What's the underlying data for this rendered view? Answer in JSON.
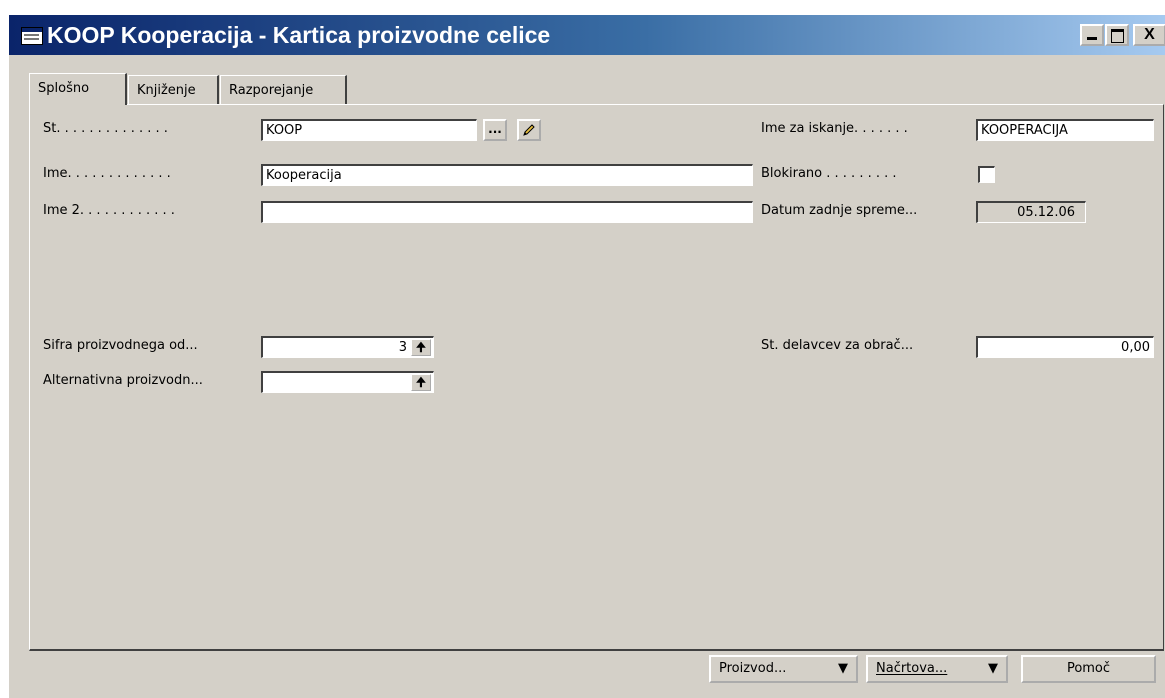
{
  "window": {
    "title": "KOOP Kooperacija - Kartica proizvodne celice",
    "minimize_glyph": "_",
    "close_glyph": "X"
  },
  "tabs": [
    {
      "label": "Splošno",
      "active": true
    },
    {
      "label": "Knjiženje",
      "active": false
    },
    {
      "label": "Razporejanje",
      "active": false
    }
  ],
  "fields": {
    "st": {
      "label": "Št. . . . . . . . . . . . . .",
      "value": "KOOP"
    },
    "ime": {
      "label": "Ime. . . . . . . . . . . . .",
      "value": "Kooperacija"
    },
    "ime2": {
      "label": "Ime 2. . . . . . . . . . . .",
      "value": ""
    },
    "sifra": {
      "label": "Šifra proizvodnega od...",
      "value": "3"
    },
    "alternativna": {
      "label": "Alternativna proizvodn...",
      "value": ""
    },
    "ime_za_iskanje": {
      "label": "Ime za iskanje. . . . . . .",
      "value": "KOOPERACIJA"
    },
    "blokirano": {
      "label": "Blokirano . . . . . . . . .",
      "checked": false
    },
    "datum": {
      "label": "Datum zadnje spreme...",
      "value": "05.12.06"
    },
    "st_delavcev": {
      "label": "Št. delavcev za obrač...",
      "value": "0,00"
    }
  },
  "icons": {
    "lookup_button": "ellipsis-icon",
    "edit_button": "pencil-icon",
    "lookup_glyph": "...",
    "arrow_glyph": "🠉"
  },
  "buttons": {
    "proizvod": "Proizvod...",
    "nacrtova": "Načrtova...",
    "pomoc": "Pomoč",
    "dropdown_glyph": "▼"
  }
}
